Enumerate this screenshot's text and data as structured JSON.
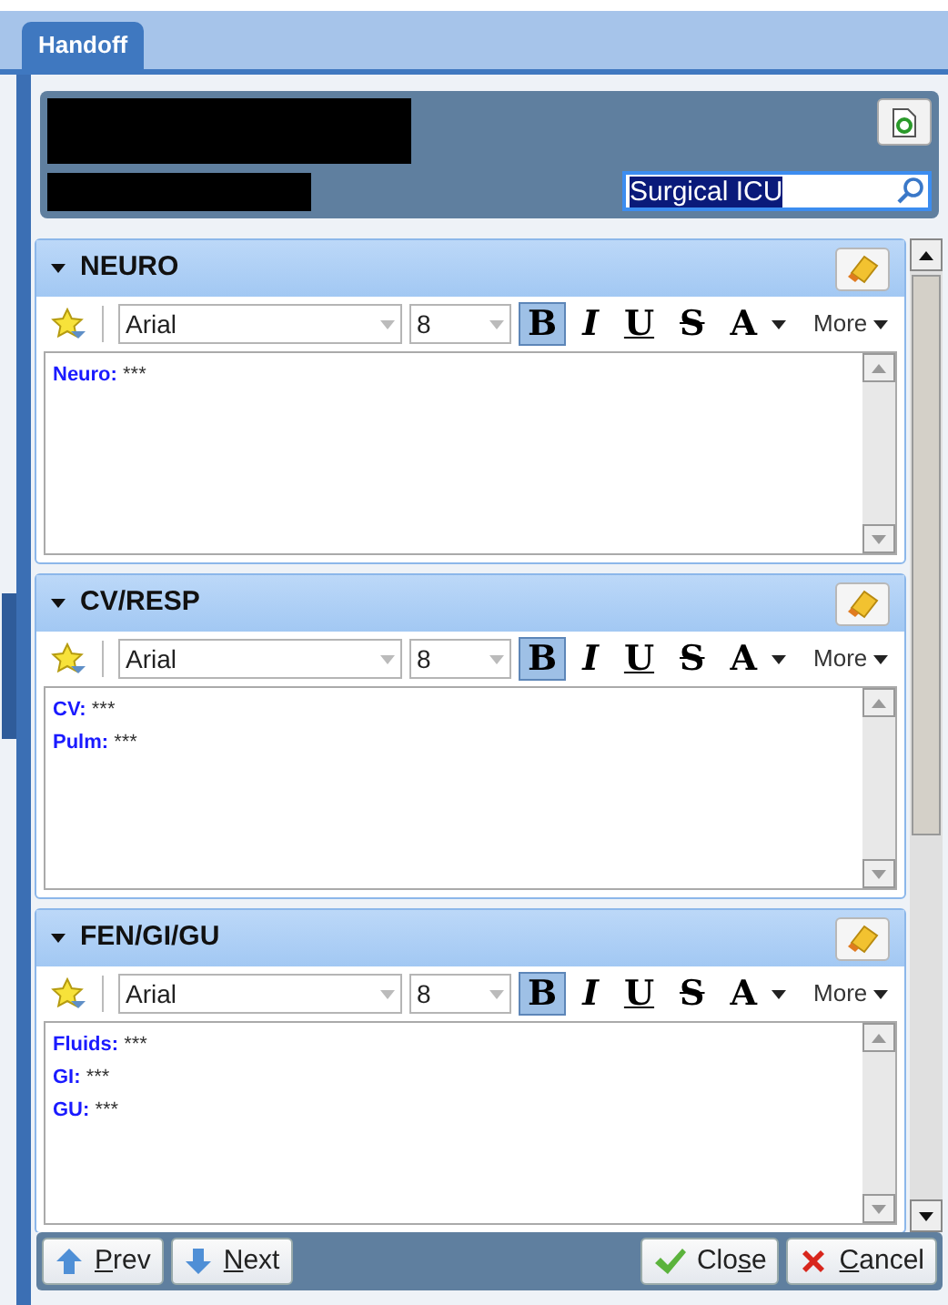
{
  "tab": {
    "label": "Handoff",
    "selected": true
  },
  "header": {
    "unit_search": {
      "value": "Surgical ICU",
      "selected": true
    }
  },
  "sections": [
    {
      "title": "NEURO",
      "expanded": true,
      "font": "Arial",
      "size": "8",
      "more": "More",
      "format_buttons": [
        {
          "kind": "bold",
          "label": "B",
          "selected": true
        },
        {
          "kind": "italic",
          "label": "I",
          "selected": false
        },
        {
          "kind": "underline",
          "label": "U",
          "selected": false
        },
        {
          "kind": "strike",
          "label": "S",
          "selected": false
        },
        {
          "kind": "color",
          "label": "A",
          "selected": false
        }
      ],
      "lines": [
        {
          "label": "Neuro:",
          "value": "***"
        }
      ]
    },
    {
      "title": "CV/RESP",
      "expanded": true,
      "font": "Arial",
      "size": "8",
      "more": "More",
      "format_buttons": [
        {
          "kind": "bold",
          "label": "B",
          "selected": true
        },
        {
          "kind": "italic",
          "label": "I",
          "selected": false
        },
        {
          "kind": "underline",
          "label": "U",
          "selected": false
        },
        {
          "kind": "strike",
          "label": "S",
          "selected": false
        },
        {
          "kind": "color",
          "label": "A",
          "selected": false
        }
      ],
      "lines": [
        {
          "label": "CV:",
          "value": "***"
        },
        {
          "label": "Pulm:",
          "value": "***"
        }
      ]
    },
    {
      "title": "FEN/GI/GU",
      "expanded": true,
      "font": "Arial",
      "size": "8",
      "more": "More",
      "format_buttons": [
        {
          "kind": "bold",
          "label": "B",
          "selected": true
        },
        {
          "kind": "italic",
          "label": "I",
          "selected": false
        },
        {
          "kind": "underline",
          "label": "U",
          "selected": false
        },
        {
          "kind": "strike",
          "label": "S",
          "selected": false
        },
        {
          "kind": "color",
          "label": "A",
          "selected": false
        }
      ],
      "lines": [
        {
          "label": "Fluids:",
          "value": "***"
        },
        {
          "label": "GI:",
          "value": "***"
        },
        {
          "label": "GU:",
          "value": "***"
        }
      ]
    }
  ],
  "footer_buttons": [
    {
      "kind": "prev",
      "mnemonic": "P",
      "after": "rev"
    },
    {
      "kind": "next",
      "mnemonic": "N",
      "after": "ext"
    },
    {
      "kind": "close",
      "before": "Clo",
      "mnemonic": "s",
      "after": "e"
    },
    {
      "kind": "cancel",
      "mnemonic": "C",
      "after": "ancel"
    }
  ]
}
